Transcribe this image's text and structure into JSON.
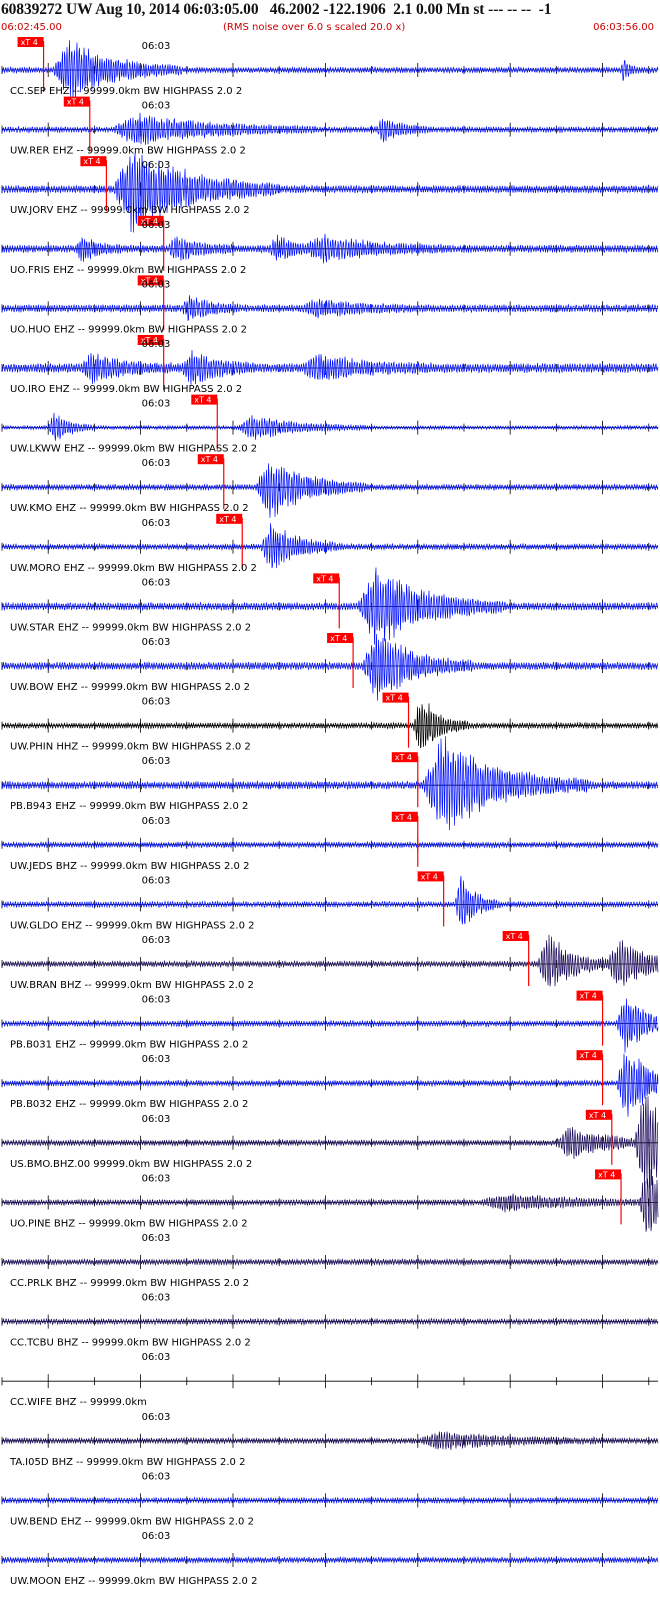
{
  "header": {
    "title": "60839272 UW Aug 10, 2014 06:03:05.00   46.2002 -122.1906  2.1 0.00 Mn st --- -- --  -1",
    "start_time": "06:02:45.00",
    "rms_note": "(RMS noise over 6.0 s scaled 20.0 x)",
    "end_time": "06:03:56.00"
  },
  "chart_data": {
    "type": "line",
    "title": "60839272 UW Aug 10, 2014 06:03:05.00   46.2002 -122.1906  2.1 0.00 Mn st --- -- --  -1",
    "x_start_time": "06:02:45.00",
    "x_end_time": "06:03:56.00",
    "x_range_seconds": [
      0,
      71
    ],
    "minute_tick_label": "06:03",
    "minute_tick_second": 15,
    "pick_label": "xT 4",
    "colors": {
      "trace_blue": "#0010ff",
      "trace_purple": "#1a0a5c",
      "trace_black": "#000000",
      "pick": "#ff0000"
    },
    "traces": [
      {
        "label": "CC.SEP EHZ -- 99999.0km BW  HIGHPASS  2.0  2",
        "color": "trace_blue",
        "pick_s": 4.5,
        "amp": 3,
        "events": [
          [
            5.5,
            14,
            8
          ],
          [
            67,
            2,
            3
          ]
        ]
      },
      {
        "label": "UW.RER EHZ -- 99999.0km BW  HIGHPASS  2.0  2",
        "color": "trace_blue",
        "pick_s": 9.5,
        "amp": 3,
        "events": [
          [
            12,
            22,
            4
          ],
          [
            40.5,
            6,
            3
          ]
        ]
      },
      {
        "label": "UW.JORV EHZ -- 99999.0km BW  HIGHPASS  2.0  2",
        "color": "trace_blue",
        "pick_s": 11.3,
        "amp": 4,
        "events": [
          [
            12,
            18,
            11
          ]
        ]
      },
      {
        "label": "UO.FRIS EHZ -- 99999.0km BW  HIGHPASS  2.0  2",
        "color": "trace_blue",
        "pick_s": 17.5,
        "amp": 4,
        "events": [
          [
            8,
            5,
            3
          ],
          [
            18,
            7,
            3
          ],
          [
            29,
            6,
            3
          ],
          [
            33,
            16,
            3
          ]
        ]
      },
      {
        "label": "UO.HUO EHZ -- 99999.0km BW  HIGHPASS  2.0  2",
        "color": "trace_blue",
        "pick_s": 17.5,
        "amp": 4,
        "events": [
          [
            19.5,
            6,
            3
          ],
          [
            32.5,
            12,
            2
          ]
        ]
      },
      {
        "label": "UO.IRO EHZ -- 99999.0km BW  HIGHPASS  2.0  2",
        "color": "trace_blue",
        "pick_s": 17.5,
        "amp": 5,
        "events": [
          [
            8.5,
            10,
            3
          ],
          [
            19.5,
            8,
            4
          ],
          [
            32.5,
            14,
            3
          ]
        ]
      },
      {
        "label": "UW.LKWW EHZ -- 99999.0km BW  HIGHPASS  2.0  2",
        "color": "trace_blue",
        "pick_s": 23.3,
        "amp": 2,
        "events": [
          [
            5,
            5,
            4
          ],
          [
            25.5,
            14,
            3
          ]
        ]
      },
      {
        "label": "UW.KMO EHZ -- 99999.0km BW  HIGHPASS  2.0  2",
        "color": "trace_blue",
        "pick_s": 24,
        "amp": 3,
        "events": [
          [
            27.5,
            12,
            8
          ]
        ]
      },
      {
        "label": "UW.MORO EHZ -- 99999.0km BW  HIGHPASS  2.0  2",
        "color": "trace_blue",
        "pick_s": 26,
        "amp": 3,
        "events": [
          [
            28,
            9,
            6
          ]
        ]
      },
      {
        "label": "UW.STAR EHZ -- 99999.0km BW  HIGHPASS  2.0  2",
        "color": "trace_blue",
        "pick_s": 36.5,
        "amp": 4,
        "events": [
          [
            38.5,
            16,
            10
          ]
        ]
      },
      {
        "label": "UW.BOW EHZ -- 99999.0km BW  HIGHPASS  2.0  2",
        "color": "trace_blue",
        "pick_s": 38,
        "amp": 4,
        "events": [
          [
            39,
            12,
            9
          ]
        ]
      },
      {
        "label": "UW.PHIN HHZ -- 99999.0km BW  HIGHPASS  2.0  2",
        "color": "trace_black",
        "pick_s": 44,
        "amp": 3,
        "events": [
          [
            44.5,
            6,
            8
          ]
        ]
      },
      {
        "label": "PB.B943 EHZ -- 99999.0km BW  HIGHPASS  2.0  2",
        "color": "trace_blue",
        "pick_s": 45,
        "amp": 4,
        "events": [
          [
            45.5,
            18,
            12
          ]
        ]
      },
      {
        "label": "UW.JEDS BHZ -- 99999.0km BW  HIGHPASS  2.0  2",
        "color": "trace_blue",
        "pick_s": 45,
        "amp": 3,
        "events": []
      },
      {
        "label": "UW.GLDO EHZ -- 99999.0km BW  HIGHPASS  2.0  2",
        "color": "trace_blue",
        "pick_s": 47.8,
        "amp": 3,
        "events": [
          [
            49,
            5,
            7
          ]
        ]
      },
      {
        "label": "UW.BRAN BHZ -- 99999.0km BW  HIGHPASS  2.0  2",
        "color": "trace_purple",
        "pick_s": 57,
        "amp": 3,
        "events": [
          [
            58,
            8,
            8
          ],
          [
            65.5,
            10,
            6
          ]
        ]
      },
      {
        "label": "PB.B031 EHZ -- 99999.0km BW  HIGHPASS  2.0  2",
        "color": "trace_blue",
        "pick_s": 65,
        "amp": 3,
        "events": [
          [
            66.5,
            8,
            7
          ]
        ]
      },
      {
        "label": "PB.B032 EHZ -- 99999.0km BW  HIGHPASS  2.0  2",
        "color": "trace_blue",
        "pick_s": 65,
        "amp": 3,
        "events": [
          [
            66.5,
            8,
            10
          ]
        ]
      },
      {
        "label": "US.BMO.BHZ.00 99999.0km BW  HIGHPASS  2.0  2",
        "color": "trace_purple",
        "pick_s": 66,
        "amp": 3,
        "events": [
          [
            60,
            12,
            4
          ],
          [
            68.5,
            8,
            14
          ]
        ]
      },
      {
        "label": "UO.PINE BHZ -- 99999.0km BW  HIGHPASS  2.0  2",
        "color": "trace_purple",
        "pick_s": 67,
        "amp": 3,
        "events": [
          [
            52,
            20,
            2
          ],
          [
            69,
            6,
            10
          ]
        ]
      },
      {
        "label": "CC.PRLK BHZ -- 99999.0km BW  HIGHPASS  2.0  2",
        "color": "trace_purple",
        "pick_s": null,
        "amp": 3,
        "events": []
      },
      {
        "label": "CC.TCBU BHZ -- 99999.0km BW  HIGHPASS  2.0  2",
        "color": "trace_purple",
        "pick_s": null,
        "amp": 3,
        "events": []
      },
      {
        "label": "CC.WIFE BHZ -- 99999.0km",
        "color": "trace_black",
        "pick_s": null,
        "amp": 0,
        "events": []
      },
      {
        "label": "TA.I05D BHZ -- 99999.0km BW  HIGHPASS  2.0  2",
        "color": "trace_purple",
        "pick_s": null,
        "amp": 3,
        "events": [
          [
            45,
            20,
            2
          ]
        ]
      },
      {
        "label": "UW.BEND EHZ -- 99999.0km BW  HIGHPASS  2.0  2",
        "color": "trace_blue",
        "pick_s": null,
        "amp": 3,
        "events": []
      },
      {
        "label": "UW.MOON EHZ -- 99999.0km BW  HIGHPASS  2.0  2",
        "color": "trace_blue",
        "pick_s": null,
        "amp": 3,
        "events": []
      }
    ]
  }
}
